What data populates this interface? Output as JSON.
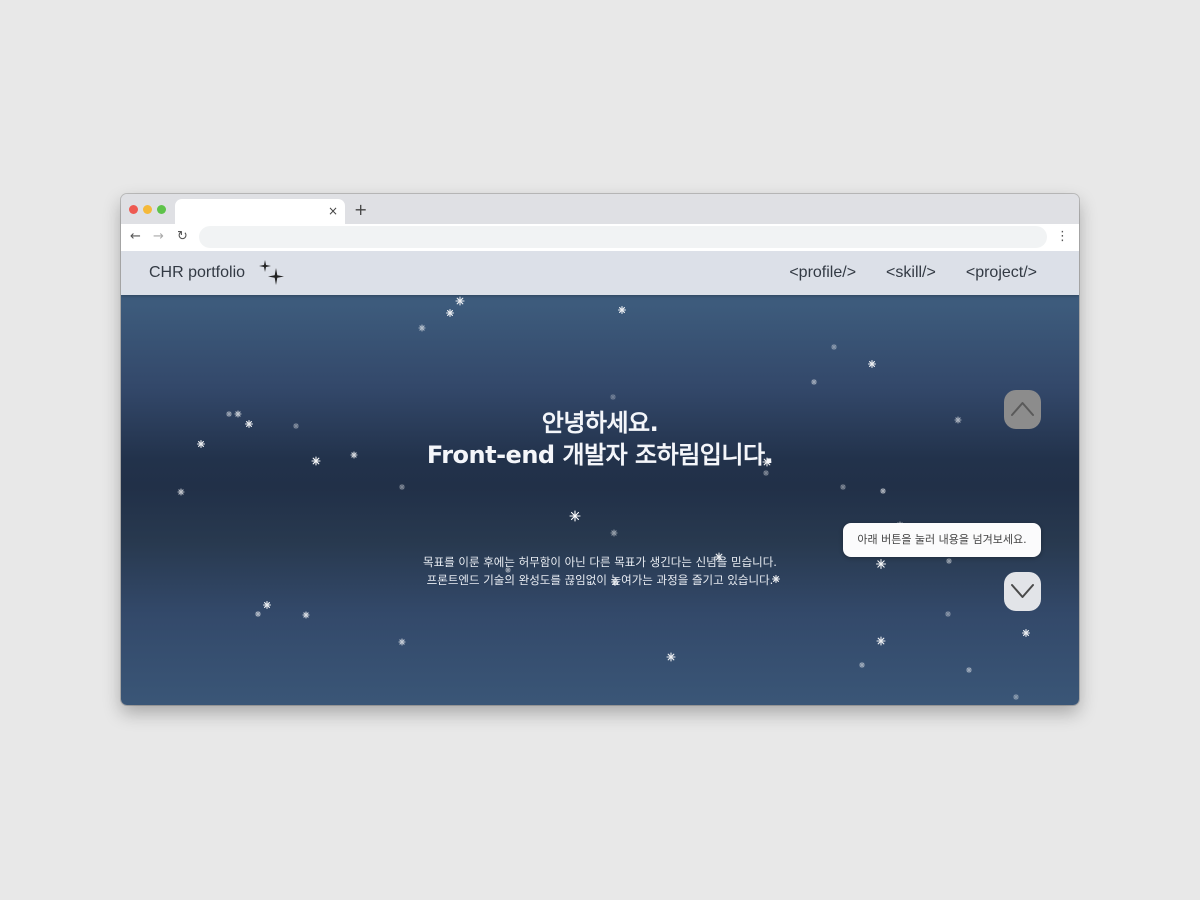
{
  "browser": {
    "tab_close": "×",
    "new_tab": "+",
    "back_icon": "arrow-left",
    "forward_icon": "arrow-right",
    "reload_icon": "reload",
    "menu_icon": "vertical-dots",
    "address_value": ""
  },
  "header": {
    "logo": "CHR portfolio",
    "nav": [
      {
        "label": "<profile/>"
      },
      {
        "label": "<skill/>"
      },
      {
        "label": "<project/>"
      }
    ]
  },
  "hero": {
    "title_line1": "안녕하세요.",
    "title_line2": "Front-end 개발자 조하림입니다.",
    "subtitle_line1": "목표를 이룬 후에는 허무함이 아닌 다른 목표가 생긴다는 신념을 믿습니다.",
    "subtitle_line2": "프론트엔드 기술의 완성도를 끊임없이 높여가는 과정을 즐기고 있습니다."
  },
  "scroll_controls": {
    "tooltip": "아래 버튼을 눌러 내용을 넘겨보세요.",
    "up_icon": "chevron-up",
    "down_icon": "chevron-down"
  },
  "colors": {
    "header_bg": "#dce0e8",
    "sky_top": "#3d5b7c",
    "sky_mid": "#213048",
    "text_light": "#f4f6fa",
    "up_button": "#8c8c8c",
    "down_button": "#e2e4e8"
  }
}
